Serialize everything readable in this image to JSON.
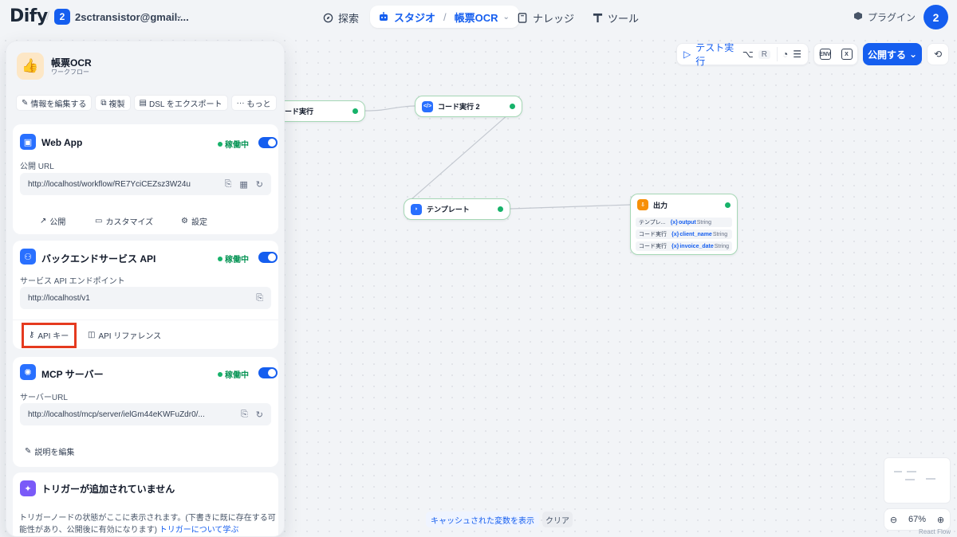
{
  "header": {
    "logo": "Dify",
    "workspace": {
      "badge": "2",
      "name": "2sctransistor@gmail...."
    },
    "nav": {
      "explore": "探索",
      "studio": "スタジオ",
      "app": "帳票OCR",
      "knowledge": "ナレッジ",
      "tools": "ツール"
    },
    "plugins": "プラグイン",
    "avatar": "2"
  },
  "toolbar": {
    "run_label": "テスト実行",
    "run_keys": [
      "⌥",
      "R"
    ],
    "env_label": "ENV",
    "var_label": "X",
    "publish_label": "公開する"
  },
  "panel": {
    "app_name": "帳票OCR",
    "app_type": "ワークフロー",
    "actions": [
      "情報を編集する",
      "複製",
      "DSL をエクスポート",
      "もっと"
    ],
    "webapp": {
      "title": "Web App",
      "status": "稼働中",
      "url_label": "公開 URL",
      "url": "http://localhost/workflow/RE7YciCEZsz3W24u",
      "links": [
        "公開",
        "カスタマイズ",
        "設定"
      ]
    },
    "backend": {
      "title": "バックエンドサービス API",
      "status": "稼働中",
      "url_label": "サービス API エンドポイント",
      "url": "http://localhost/v1",
      "links": [
        "API キー",
        "API リファレンス"
      ]
    },
    "mcp": {
      "title": "MCP サーバー",
      "status": "稼働中",
      "url_label": "サーバーURL",
      "url": "http://localhost/mcp/server/ielGm44eKWFuZdr0/...",
      "edit_label": "説明を編集"
    },
    "trigger": {
      "title": "トリガーが追加されていません",
      "desc": "トリガーノードの状態がここに表示されます。(下書きに既に存在する可能性があり、公開後に有効になります)",
      "link": "トリガーについて学ぶ"
    }
  },
  "canvas": {
    "nodes": {
      "code1": "ード実行",
      "code2": "コード実行 2",
      "template": "テンプレート",
      "output": "出力"
    },
    "output_rows": [
      {
        "src": "テンプレ...",
        "var": "output",
        "type": "String"
      },
      {
        "src": "コード実行",
        "var": "client_name",
        "type": "String"
      },
      {
        "src": "コード実行",
        "var": "invoice_date",
        "type": "String"
      }
    ],
    "cache_label": "キャッシュされた変数を表示",
    "clear_label": "クリア",
    "zoom": "67%",
    "attribution": "React Flow"
  },
  "colors": {
    "accent": "#155eef",
    "running": "#17b26a",
    "highlight": "#e53a1f"
  }
}
